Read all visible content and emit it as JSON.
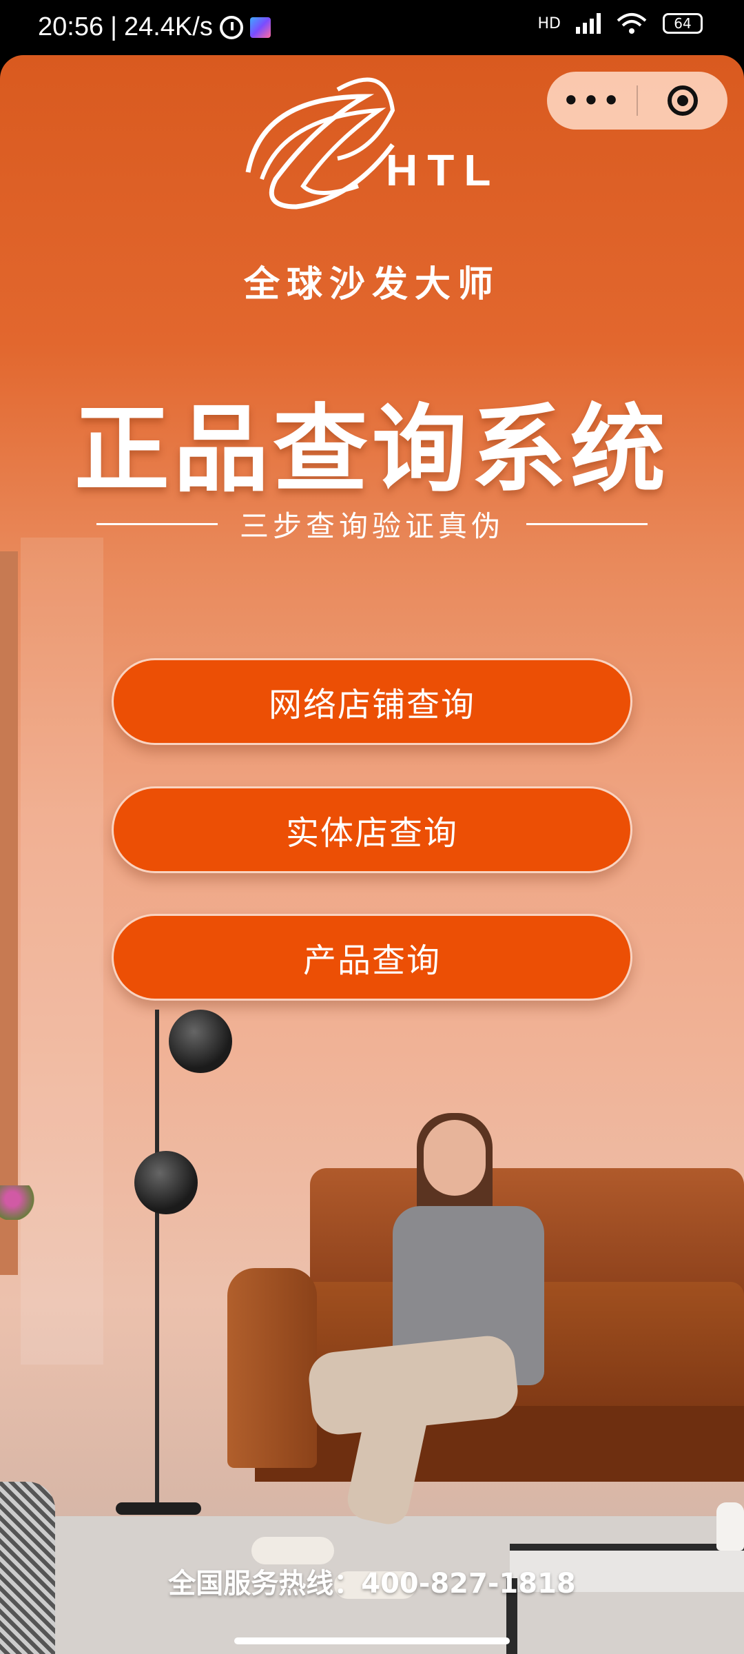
{
  "status_bar": {
    "time": "20:56",
    "separator": "|",
    "net_speed": "24.4K/s",
    "hd_label": "HD",
    "battery": "64"
  },
  "capsule": {
    "more_glyph": "•••",
    "icons": [
      "more-dots-icon",
      "target-icon"
    ]
  },
  "brand": {
    "logo_text": "HTL",
    "slogan": "全球沙发大师"
  },
  "hero": {
    "title": "正品查询系统",
    "subtitle": "三步查询验证真伪"
  },
  "buttons": {
    "online_store": "网络店铺查询",
    "physical_store": "实体店查询",
    "product": "产品查询"
  },
  "footer": {
    "hotline": "全国服务热线：400-827-1818"
  },
  "colors": {
    "accent": "#ec4f05",
    "background_top": "#d95a1f"
  }
}
